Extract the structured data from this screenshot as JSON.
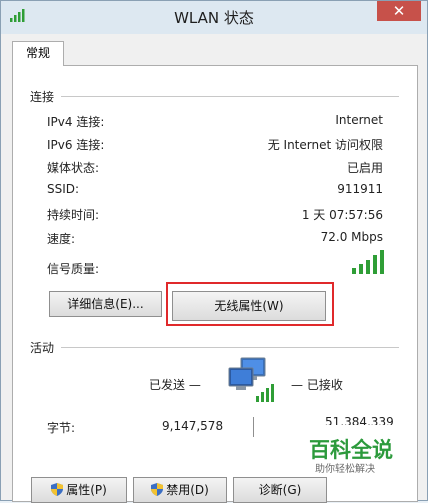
{
  "window": {
    "title": "WLAN 状态",
    "close_symbol": "✕"
  },
  "tabs": [
    {
      "label": "常规"
    }
  ],
  "connection": {
    "section_label": "连接",
    "rows": [
      {
        "label": "IPv4 连接:",
        "value": "Internet"
      },
      {
        "label": "IPv6 连接:",
        "value": "无 Internet 访问权限"
      },
      {
        "label": "媒体状态:",
        "value": "已启用"
      },
      {
        "label": "SSID:",
        "value": "911911"
      },
      {
        "label": "持续时间:",
        "value": "1 天 07:57:56"
      },
      {
        "label": "速度:",
        "value": "72.0 Mbps"
      },
      {
        "label": "信号质量:",
        "value": ""
      }
    ],
    "signal_bars": 5
  },
  "buttons": {
    "details": "详细信息(E)...",
    "wireless_properties": "无线属性(W)",
    "properties": "属性(P)",
    "disable": "禁用(D)",
    "diagnose": "诊断(G)"
  },
  "activity": {
    "section_label": "活动",
    "sent_label": "已发送 —",
    "received_label": "— 已接收",
    "bytes_label": "字节:",
    "bytes_sent": "9,147,578",
    "bytes_received": "51,384,339"
  },
  "watermark": {
    "title": "百科全说",
    "subtitle": "助你轻松解决"
  },
  "colors": {
    "signal": "#2f9e36",
    "highlight": "#e0292b"
  }
}
